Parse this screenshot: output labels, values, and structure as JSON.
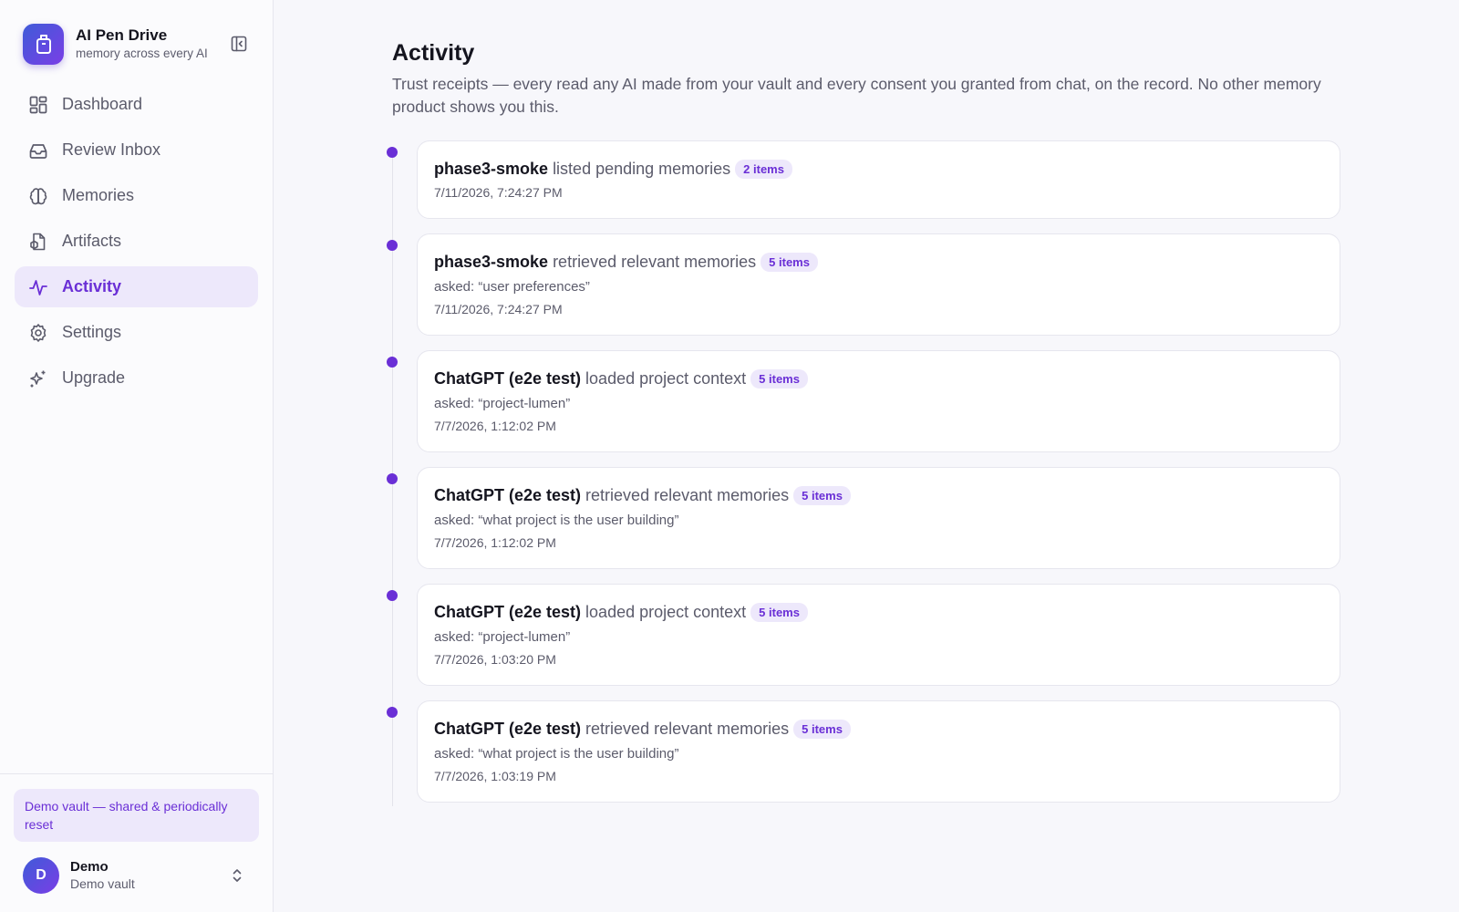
{
  "brand": {
    "name": "AI Pen Drive",
    "tagline": "memory across every AI"
  },
  "nav": [
    {
      "label": "Dashboard",
      "icon": "dashboard-icon",
      "active": false
    },
    {
      "label": "Review Inbox",
      "icon": "inbox-icon",
      "active": false
    },
    {
      "label": "Memories",
      "icon": "brain-icon",
      "active": false
    },
    {
      "label": "Artifacts",
      "icon": "artifact-icon",
      "active": false
    },
    {
      "label": "Activity",
      "icon": "activity-icon",
      "active": true
    },
    {
      "label": "Settings",
      "icon": "gear-icon",
      "active": false
    },
    {
      "label": "Upgrade",
      "icon": "sparkles-icon",
      "active": false
    }
  ],
  "footer": {
    "banner": "Demo vault — shared & periodically reset",
    "user": {
      "initial": "D",
      "name": "Demo",
      "vault": "Demo vault"
    }
  },
  "page": {
    "title": "Activity",
    "description": "Trust receipts — every read any AI made from your vault and every consent you granted from chat, on the record. No other memory product shows you this."
  },
  "entries": [
    {
      "actor": "phase3-smoke",
      "action": "listed pending memories",
      "badge": "2 items",
      "query": "",
      "time": "7/11/2026, 7:24:27 PM"
    },
    {
      "actor": "phase3-smoke",
      "action": "retrieved relevant memories",
      "badge": "5 items",
      "query": "asked: “user preferences”",
      "time": "7/11/2026, 7:24:27 PM"
    },
    {
      "actor": "ChatGPT (e2e test)",
      "action": "loaded project context",
      "badge": "5 items",
      "query": "asked: “project-lumen”",
      "time": "7/7/2026, 1:12:02 PM"
    },
    {
      "actor": "ChatGPT (e2e test)",
      "action": "retrieved relevant memories",
      "badge": "5 items",
      "query": "asked: “what project is the user building”",
      "time": "7/7/2026, 1:12:02 PM"
    },
    {
      "actor": "ChatGPT (e2e test)",
      "action": "loaded project context",
      "badge": "5 items",
      "query": "asked: “project-lumen”",
      "time": "7/7/2026, 1:03:20 PM"
    },
    {
      "actor": "ChatGPT (e2e test)",
      "action": "retrieved relevant memories",
      "badge": "5 items",
      "query": "asked: “what project is the user building”",
      "time": "7/7/2026, 1:03:19 PM"
    }
  ],
  "colors": {
    "accent": "#6a2fd6",
    "accent_bg": "#ede8fb"
  }
}
